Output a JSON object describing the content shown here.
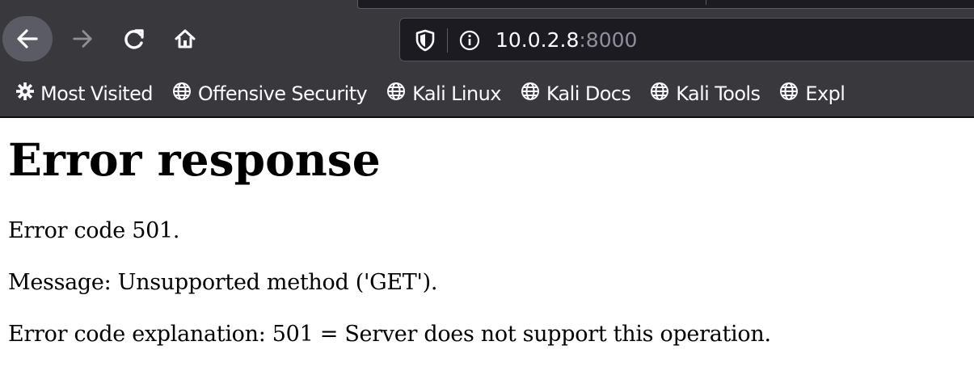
{
  "browser": {
    "nav": {
      "back_icon": "arrow-left-icon",
      "forward_icon": "arrow-right-icon",
      "reload_icon": "reload-icon",
      "home_icon": "home-icon"
    },
    "urlbar": {
      "host": "10.0.2.8",
      "port": ":8000",
      "shield_icon": "shield-icon",
      "info_icon": "info-icon"
    },
    "bookmarks": [
      {
        "label": "Most Visited",
        "icon": "gear-icon"
      },
      {
        "label": "Offensive Security",
        "icon": "globe-icon"
      },
      {
        "label": "Kali Linux",
        "icon": "globe-icon"
      },
      {
        "label": "Kali Docs",
        "icon": "globe-icon"
      },
      {
        "label": "Kali Tools",
        "icon": "globe-icon"
      },
      {
        "label": "Expl",
        "icon": "globe-icon"
      }
    ],
    "colors": {
      "toolbar": "#38383d",
      "urlbar": "#1c1b22",
      "text": "#fbfbfe",
      "port_text": "#8f8f9d"
    }
  },
  "page": {
    "heading": "Error response",
    "error_code_line": "Error code 501.",
    "message_line": "Message: Unsupported method ('GET').",
    "explanation_line": "Error code explanation: 501 = Server does not support this operation."
  }
}
